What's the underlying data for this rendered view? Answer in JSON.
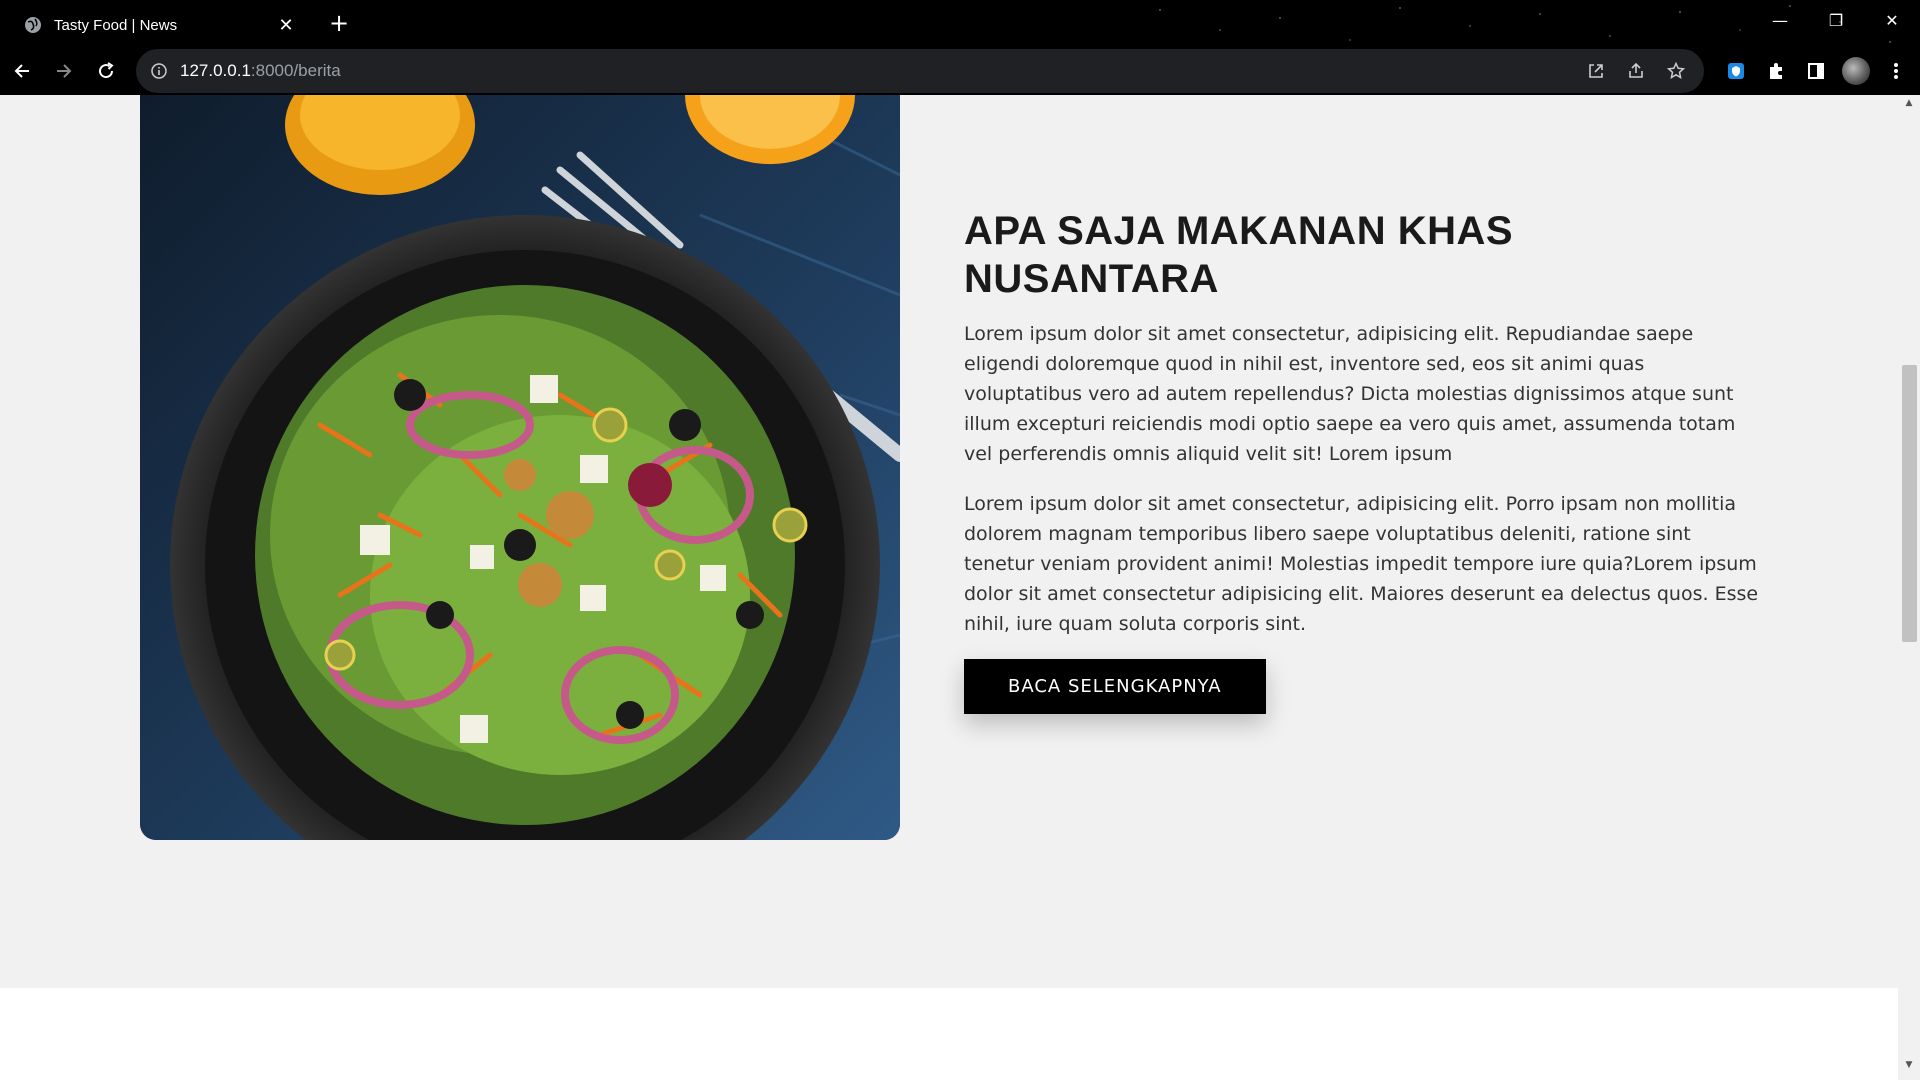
{
  "browser": {
    "tab_title": "Tasty Food | News",
    "tab_close": "✕",
    "new_tab": "+",
    "url_host": "127.0.0.1",
    "url_rest": ":8000/berita",
    "window_controls": {
      "minimize": "—",
      "restore": "❐",
      "close": "✕"
    }
  },
  "article": {
    "title": "APA SAJA MAKANAN KHAS NUSANTARA",
    "paragraph_1": "Lorem ipsum dolor sit amet consectetur, adipisicing elit. Repudiandae saepe eligendi doloremque quod in nihil est, inventore sed, eos sit animi quas voluptatibus vero ad autem repellendus? Dicta molestias dignissimos atque sunt illum excepturi reiciendis modi optio saepe ea vero quis amet, assumenda totam vel perferendis omnis aliquid velit sit! Lorem ipsum",
    "paragraph_2": "Lorem ipsum dolor sit amet consectetur, adipisicing elit. Porro ipsam non mollitia dolorem magnam temporibus libero saepe voluptatibus deleniti, ratione sint tenetur veniam provident animi! Molestias impedit tempore iure quia?Lorem ipsum dolor sit amet consectetur adipisicing elit. Maiores deserunt ea delectus quos. Esse nihil, iure quam soluta corporis sint.",
    "button_label": "BACA SELENGKAPNYA"
  },
  "colors": {
    "page_bg": "#f1f1f1",
    "button_bg": "#000000",
    "text": "#333333"
  }
}
